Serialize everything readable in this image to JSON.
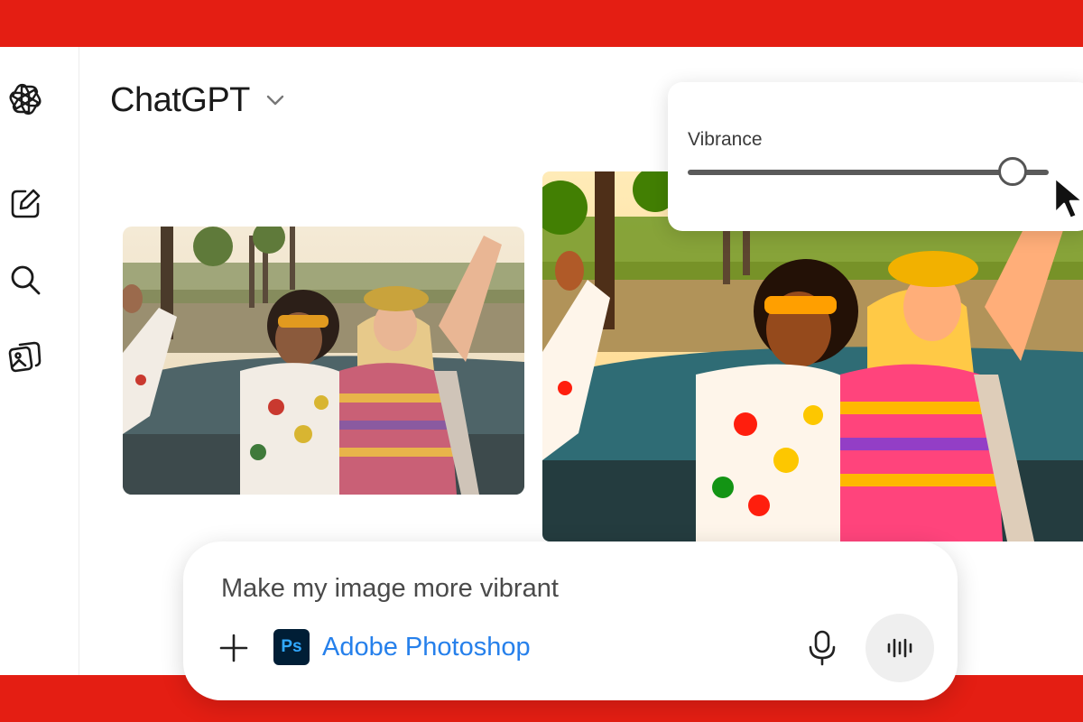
{
  "app": {
    "title": "ChatGPT",
    "accent_color": "#e41e13"
  },
  "sidebar": {
    "items": [
      {
        "name": "openai-logo-icon"
      },
      {
        "name": "new-chat-icon"
      },
      {
        "name": "search-icon"
      },
      {
        "name": "images-icon"
      }
    ]
  },
  "header": {
    "title": "ChatGPT",
    "dropdown_icon": "chevron-down-icon"
  },
  "slider_panel": {
    "label": "Vibrance",
    "value_fraction": 0.9
  },
  "composer": {
    "prompt_text": "Make my image more vibrant",
    "tool": {
      "name": "Adobe Photoshop",
      "icon_text": "Ps",
      "color": "#2680eb"
    },
    "icons": [
      "plus-icon",
      "microphone-icon",
      "voice-mode-icon"
    ]
  }
}
